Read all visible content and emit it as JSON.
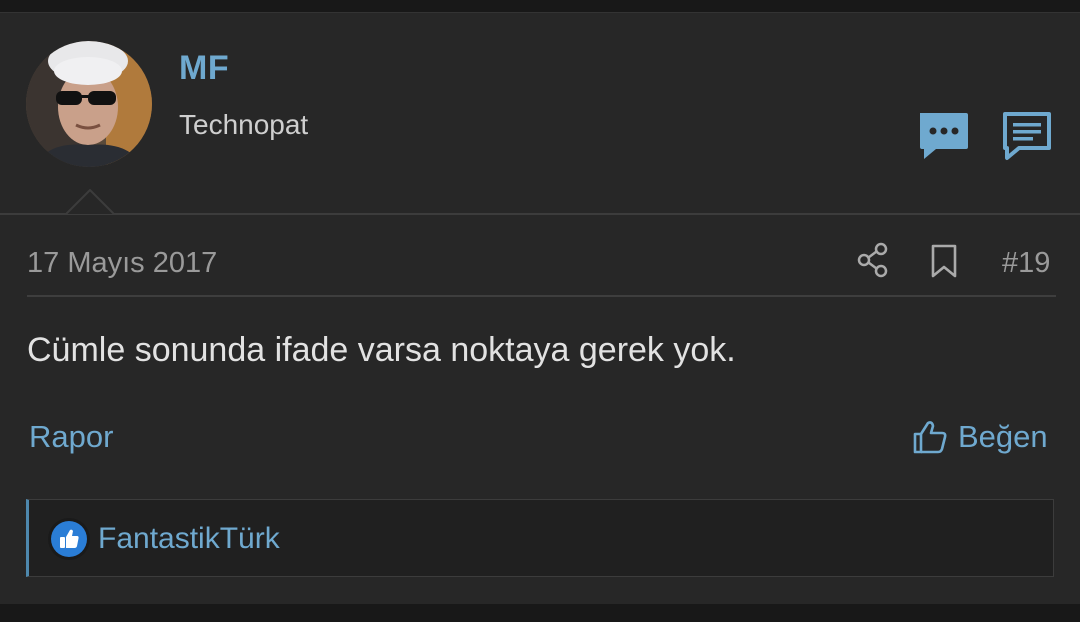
{
  "user": {
    "name": "MF",
    "title": "Technopat"
  },
  "post": {
    "date": "17 Mayıs 2017",
    "number": "#19",
    "body": "Cümle sonunda ifade varsa noktaya gerek yok."
  },
  "actions": {
    "report_label": "Rapor",
    "like_label": "Beğen"
  },
  "reactions": {
    "users": "FantastikTürk"
  },
  "icons": {
    "chat": "chat-bubble-icon",
    "message": "message-icon",
    "share": "share-icon",
    "bookmark": "bookmark-icon",
    "like": "thumbs-up-icon",
    "reaction": "like-reaction-icon"
  },
  "colors": {
    "accent": "#6fa9cf",
    "background": "#272727",
    "text": "#e2e2e2",
    "muted": "#9a9a9a",
    "reaction_badge": "#2a7dd6"
  }
}
